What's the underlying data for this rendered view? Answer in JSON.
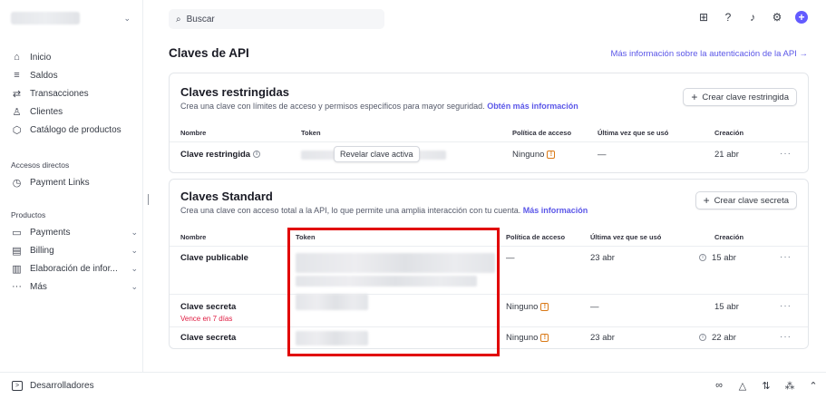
{
  "search": {
    "placeholder": "Buscar"
  },
  "sidebar": {
    "nav": [
      {
        "icon": "home-icon",
        "label": "Inicio"
      },
      {
        "icon": "balance-icon",
        "label": "Saldos"
      },
      {
        "icon": "arrows-icon",
        "label": "Transacciones"
      },
      {
        "icon": "person-icon",
        "label": "Clientes"
      },
      {
        "icon": "box-icon",
        "label": "Catálogo de productos"
      }
    ],
    "shortcuts_title": "Accesos directos",
    "shortcuts": [
      {
        "icon": "clock-icon",
        "label": "Payment Links"
      }
    ],
    "products_title": "Productos",
    "products": [
      {
        "icon": "wallet-icon",
        "label": "Payments"
      },
      {
        "icon": "invoice-icon",
        "label": "Billing"
      },
      {
        "icon": "chart-icon",
        "label": "Elaboración de infor..."
      },
      {
        "icon": "more-icon",
        "label": "Más"
      }
    ]
  },
  "page": {
    "title": "Claves de API",
    "more_link": "Más información sobre la autenticación de la API →"
  },
  "restricted": {
    "title": "Claves restringidas",
    "description": "Crea una clave con límites de acceso y permisos específicos para mayor seguridad.",
    "link": "Obtén más información",
    "button": "Crear clave restringida",
    "headers": {
      "name": "Nombre",
      "token": "Token",
      "policy": "Política de acceso",
      "last_used": "Última vez que se usó",
      "created": "Creación"
    },
    "row": {
      "name": "Clave restringida",
      "reveal": "Revelar clave activa",
      "policy": "Ninguno",
      "last_used": "—",
      "created": "21 abr",
      "menu": "···"
    }
  },
  "standard": {
    "title": "Claves Standard",
    "description": "Crea una clave con acceso total a la API, lo que permite una amplia interacción con tu cuenta.",
    "link": "Más información",
    "button": "Crear clave secreta",
    "headers": {
      "name": "Nombre",
      "token": "Token",
      "policy": "Política de acceso",
      "last_used": "Última vez que se usó",
      "created": "Creación"
    },
    "rows": [
      {
        "name": "Clave publicable",
        "subtitle": "",
        "policy": "—",
        "last_used": "23 abr",
        "created": "15 abr",
        "menu": "···"
      },
      {
        "name": "Clave secreta",
        "subtitle": "Vence en 7 días",
        "policy": "Ninguno",
        "last_used": "—",
        "created": "15 abr",
        "menu": "···"
      },
      {
        "name": "Clave secreta",
        "subtitle": "",
        "policy": "Ninguno",
        "last_used": "23 abr",
        "created": "22 abr",
        "menu": "···"
      }
    ]
  },
  "bottom": {
    "developers": "Desarrolladores"
  },
  "colors": {
    "accent": "#635bff",
    "link": "#5b57e8",
    "warning": "#d97917",
    "danger": "#df1b41",
    "highlight": "#e10000"
  }
}
